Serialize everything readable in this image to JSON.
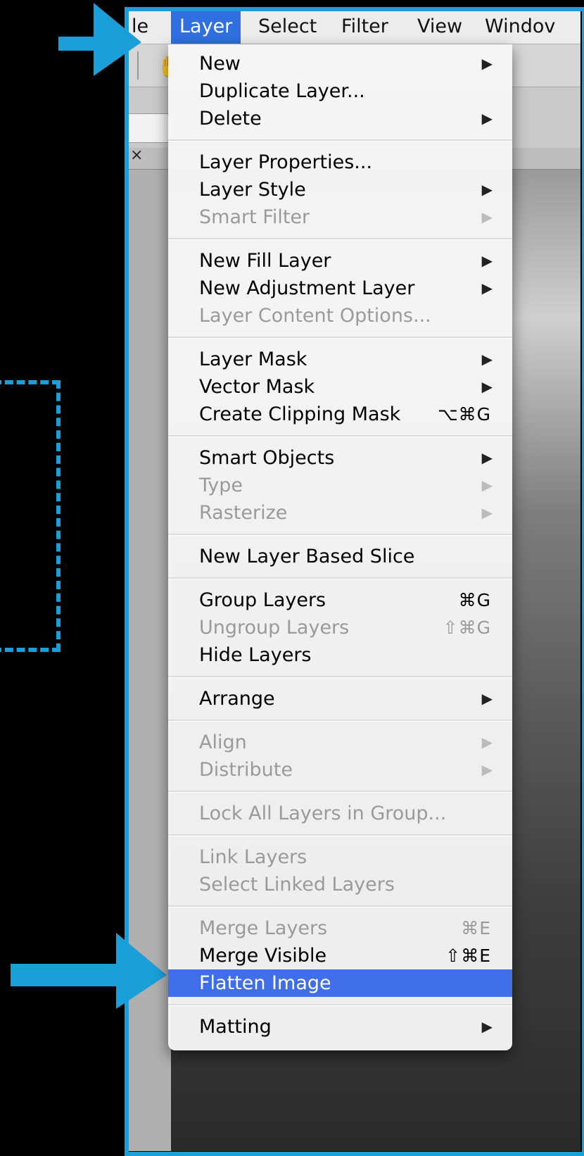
{
  "menubar": {
    "items": [
      {
        "label": "le"
      },
      {
        "label": "Layer"
      },
      {
        "label": "Select"
      },
      {
        "label": "Filter"
      },
      {
        "label": "View"
      },
      {
        "label": "Windov"
      }
    ]
  },
  "icons": {
    "hand_tool": "hand-icon",
    "doc_close": "close-icon",
    "submenu": "▶"
  },
  "colors": {
    "highlight": "#1b9fd8",
    "selection": "#3f6ee8"
  },
  "layer_menu": {
    "groups": [
      [
        {
          "label": "New",
          "submenu": true,
          "enabled": true
        },
        {
          "label": "Duplicate Layer...",
          "enabled": true
        },
        {
          "label": "Delete",
          "submenu": true,
          "enabled": true
        }
      ],
      [
        {
          "label": "Layer Properties...",
          "enabled": true
        },
        {
          "label": "Layer Style",
          "submenu": true,
          "enabled": true
        },
        {
          "label": "Smart Filter",
          "submenu": true,
          "enabled": false
        }
      ],
      [
        {
          "label": "New Fill Layer",
          "submenu": true,
          "enabled": true
        },
        {
          "label": "New Adjustment Layer",
          "submenu": true,
          "enabled": true
        },
        {
          "label": "Layer Content Options...",
          "enabled": false
        }
      ],
      [
        {
          "label": "Layer Mask",
          "submenu": true,
          "enabled": true
        },
        {
          "label": "Vector Mask",
          "submenu": true,
          "enabled": true
        },
        {
          "label": "Create Clipping Mask",
          "shortcut": "⌥⌘G",
          "enabled": true
        }
      ],
      [
        {
          "label": "Smart Objects",
          "submenu": true,
          "enabled": true
        },
        {
          "label": "Type",
          "submenu": true,
          "enabled": false
        },
        {
          "label": "Rasterize",
          "submenu": true,
          "enabled": false
        }
      ],
      [
        {
          "label": "New Layer Based Slice",
          "enabled": true
        }
      ],
      [
        {
          "label": "Group Layers",
          "shortcut": "⌘G",
          "enabled": true
        },
        {
          "label": "Ungroup Layers",
          "shortcut": "⇧⌘G",
          "enabled": false
        },
        {
          "label": "Hide Layers",
          "enabled": true
        }
      ],
      [
        {
          "label": "Arrange",
          "submenu": true,
          "enabled": true
        }
      ],
      [
        {
          "label": "Align",
          "submenu": true,
          "enabled": false
        },
        {
          "label": "Distribute",
          "submenu": true,
          "enabled": false
        }
      ],
      [
        {
          "label": "Lock All Layers in Group...",
          "enabled": false
        }
      ],
      [
        {
          "label": "Link Layers",
          "enabled": false
        },
        {
          "label": "Select Linked Layers",
          "enabled": false
        }
      ],
      [
        {
          "label": "Merge Layers",
          "shortcut": "⌘E",
          "enabled": false
        },
        {
          "label": "Merge Visible",
          "shortcut": "⇧⌘E",
          "enabled": true
        },
        {
          "label": "Flatten Image",
          "enabled": true,
          "selected": true
        }
      ],
      [
        {
          "label": "Matting",
          "submenu": true,
          "enabled": true
        }
      ]
    ]
  }
}
